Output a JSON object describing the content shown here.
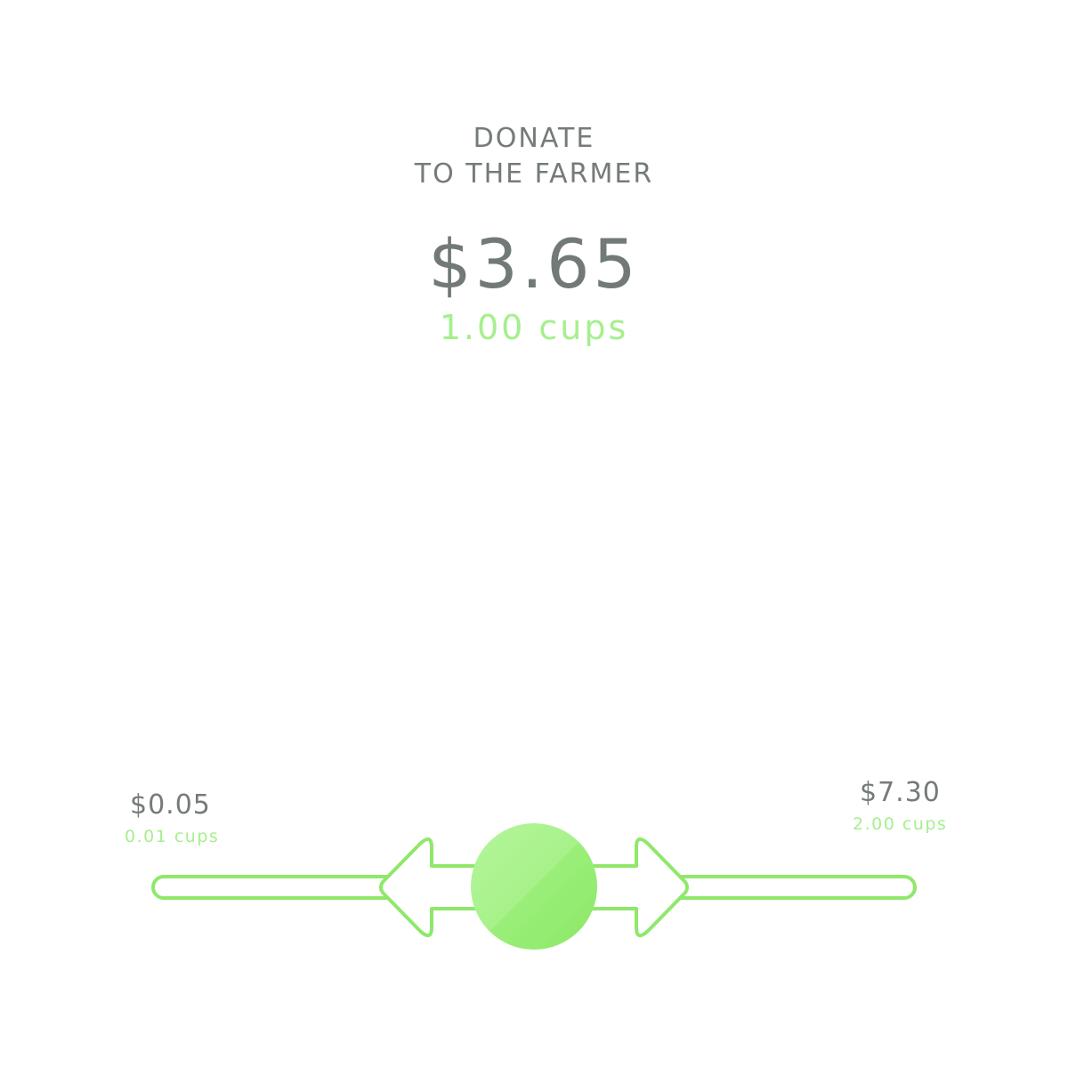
{
  "header": {
    "title_line1": "DONATE",
    "title_line2": "TO THE FARMER"
  },
  "donation": {
    "amount": "$3.65",
    "cups": "1.00 cups"
  },
  "slider": {
    "min_price": "$0.05",
    "min_cups": "0.01 cups",
    "max_price": "$7.30",
    "max_cups": "2.00 cups",
    "value_fraction": 0.5,
    "track_color": "#8fe86a",
    "knob_color": "#a8f28a",
    "knob_shade_color": "#8fe86a"
  },
  "colors": {
    "text_gray": "#747b78",
    "accent_green": "#a5f08c"
  }
}
